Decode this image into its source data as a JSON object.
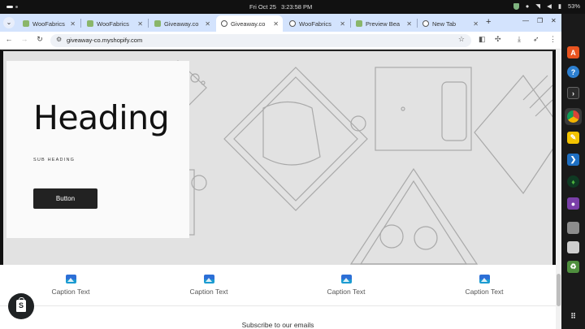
{
  "system": {
    "date": "Fri Oct 25",
    "time": "3:23:58 PM",
    "battery": "53%"
  },
  "browser": {
    "tabs": [
      {
        "title": "WooFabrics",
        "favicon": "woo-icon"
      },
      {
        "title": "WooFabrics",
        "favicon": "woo-icon"
      },
      {
        "title": "Giveaway.co",
        "favicon": "woo-icon"
      },
      {
        "title": "Giveaway.co",
        "favicon": "globe-icon",
        "active": true
      },
      {
        "title": "WooFabrics",
        "favicon": "globe-icon"
      },
      {
        "title": "Preview Bea",
        "favicon": "woo-icon"
      },
      {
        "title": "New Tab",
        "favicon": "chrome-icon"
      }
    ],
    "new_tab_symbol": "+",
    "url": "giveaway-co.myshopify.com"
  },
  "hero": {
    "heading": "Heading",
    "subheading": "SUB HEADING",
    "button_label": "Button"
  },
  "captions": [
    {
      "text": "Caption Text",
      "icon": "image-icon"
    },
    {
      "text": "Caption Text",
      "icon": "image-icon"
    },
    {
      "text": "Caption Text",
      "icon": "image-icon"
    },
    {
      "text": "Caption Text",
      "icon": "image-icon"
    }
  ],
  "footer": {
    "subscribe_heading": "Subscribe to our emails"
  },
  "colors": {
    "tab_strip": "#d3e3fd",
    "hero_bg": "#e2e2e2",
    "button_bg": "#222222"
  },
  "dock": [
    "app-center-icon",
    "help-icon",
    "terminal-icon",
    "chrome-icon",
    "text-editor-icon",
    "vscode-icon",
    "mongodb-icon",
    "github-desktop-icon",
    "files-icon",
    "file-icon",
    "trash-icon",
    "show-apps-icon"
  ]
}
